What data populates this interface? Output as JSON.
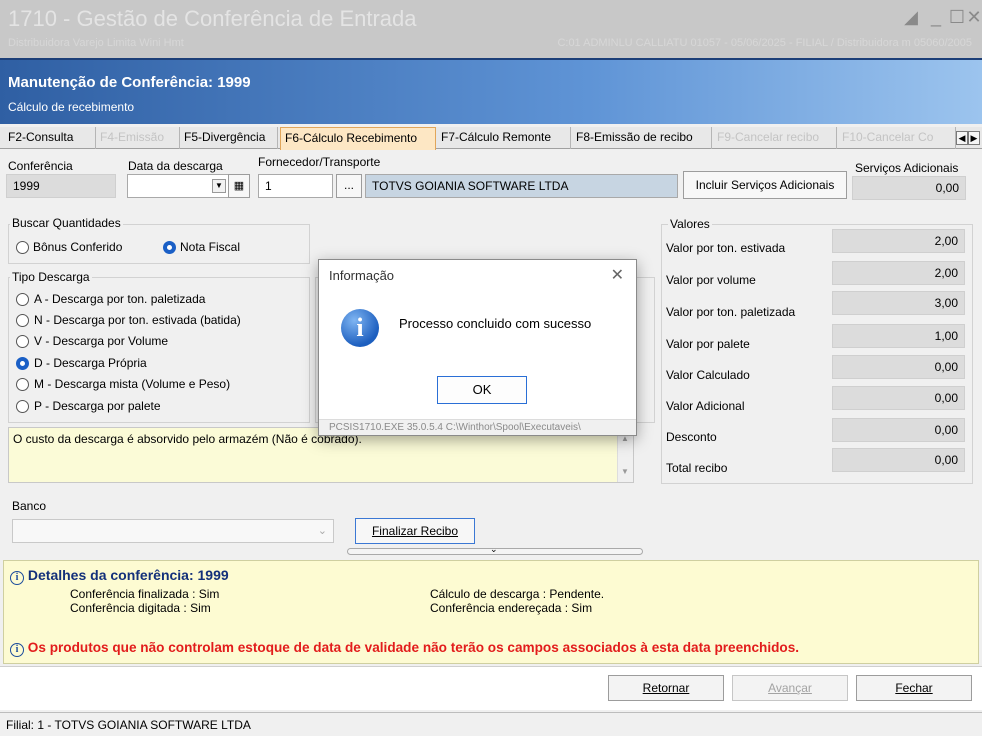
{
  "window": {
    "title": "1710 - Gestão de Conferência de Entrada",
    "subtitle_left": "Distribuidora Varejo Limita Wini Hmt",
    "subtitle_right": "C:01 ADMINLU CALLIATU 01057 - 05/06/2025 - FILIAL / Distribuidora m 05060/2005"
  },
  "header": {
    "title": "Manutenção de Conferência: 1999",
    "subtitle": "Cálculo de recebimento"
  },
  "tabs": [
    {
      "label": "F2-Consulta"
    },
    {
      "label": "F4-Emissão"
    },
    {
      "label": "F5-Divergência"
    },
    {
      "label": "F6-Cálculo Recebimento"
    },
    {
      "label": "F7-Cálculo Remonte"
    },
    {
      "label": "F8-Emissão de recibo"
    },
    {
      "label": "F9-Cancelar recibo"
    },
    {
      "label": "F10-Cancelar Co"
    }
  ],
  "form": {
    "conferencia_label": "Conferência",
    "conferencia_value": "1999",
    "data_descarga_label": "Data da descarga",
    "fornecedor_label": "Fornecedor/Transporte",
    "fornecedor_code": "1",
    "fornecedor_name": "TOTVS GOIANIA SOFTWARE LTDA",
    "browse_label": "...",
    "incluir_label": "Incluir Serviços Adicionais",
    "servicos_label": "Serviços Adicionais",
    "servicos_value": "0,00"
  },
  "buscar": {
    "title": "Buscar Quantidades",
    "options": [
      "Bônus Conferido",
      "Nota Fiscal"
    ]
  },
  "tipo_descarga": {
    "title": "Tipo Descarga",
    "options": [
      "A - Descarga por ton. paletizada",
      "N - Descarga por ton. estivada (batida)",
      "V - Descarga por Volume",
      "D - Descarga Própria",
      "M - Descarga mista (Volume e Peso)",
      "P -  Descarga por palete"
    ]
  },
  "valores": {
    "title": "Valores",
    "rows": [
      {
        "label": "Valor por ton. estivada",
        "value": "2,00"
      },
      {
        "label": "Valor por volume",
        "value": "2,00"
      },
      {
        "label": "Valor por ton. paletizada",
        "value": "3,00"
      },
      {
        "label": "Valor por palete",
        "value": "1,00"
      },
      {
        "label": "Valor Calculado",
        "value": "0,00"
      },
      {
        "label": "Valor Adicional",
        "value": "0,00"
      },
      {
        "label": "Desconto",
        "value": "0,00"
      },
      {
        "label": "Total recibo",
        "value": "0,00"
      }
    ]
  },
  "message": "O custo da descarga é absorvido pelo armazém (Não é cobrado).",
  "banco": {
    "label": "Banco",
    "finalizar_label": "Finalizar Recibo"
  },
  "details": {
    "title": "Detalhes da conferência: 1999",
    "left": [
      "Conferência finalizada : Sim",
      "Conferência digitada : Sim"
    ],
    "right": [
      "Cálculo de descarga : Pendente.",
      "Conferência endereçada : Sim"
    ],
    "warning": "Os produtos que não controlam estoque de data de validade não terão os campos associados à esta data preenchidos."
  },
  "footer": {
    "retornar": "Retornar",
    "avancar": "Avançar",
    "fechar": "Fechar"
  },
  "status": "Filial: 1 - TOTVS GOIANIA SOFTWARE LTDA",
  "dialog": {
    "title": "Informação",
    "message": "Processo concluido com sucesso",
    "ok": "OK",
    "footer": "PCSIS1710.EXE 35.0.5.4 C:\\Winthor\\Spool\\Executaveis\\"
  }
}
